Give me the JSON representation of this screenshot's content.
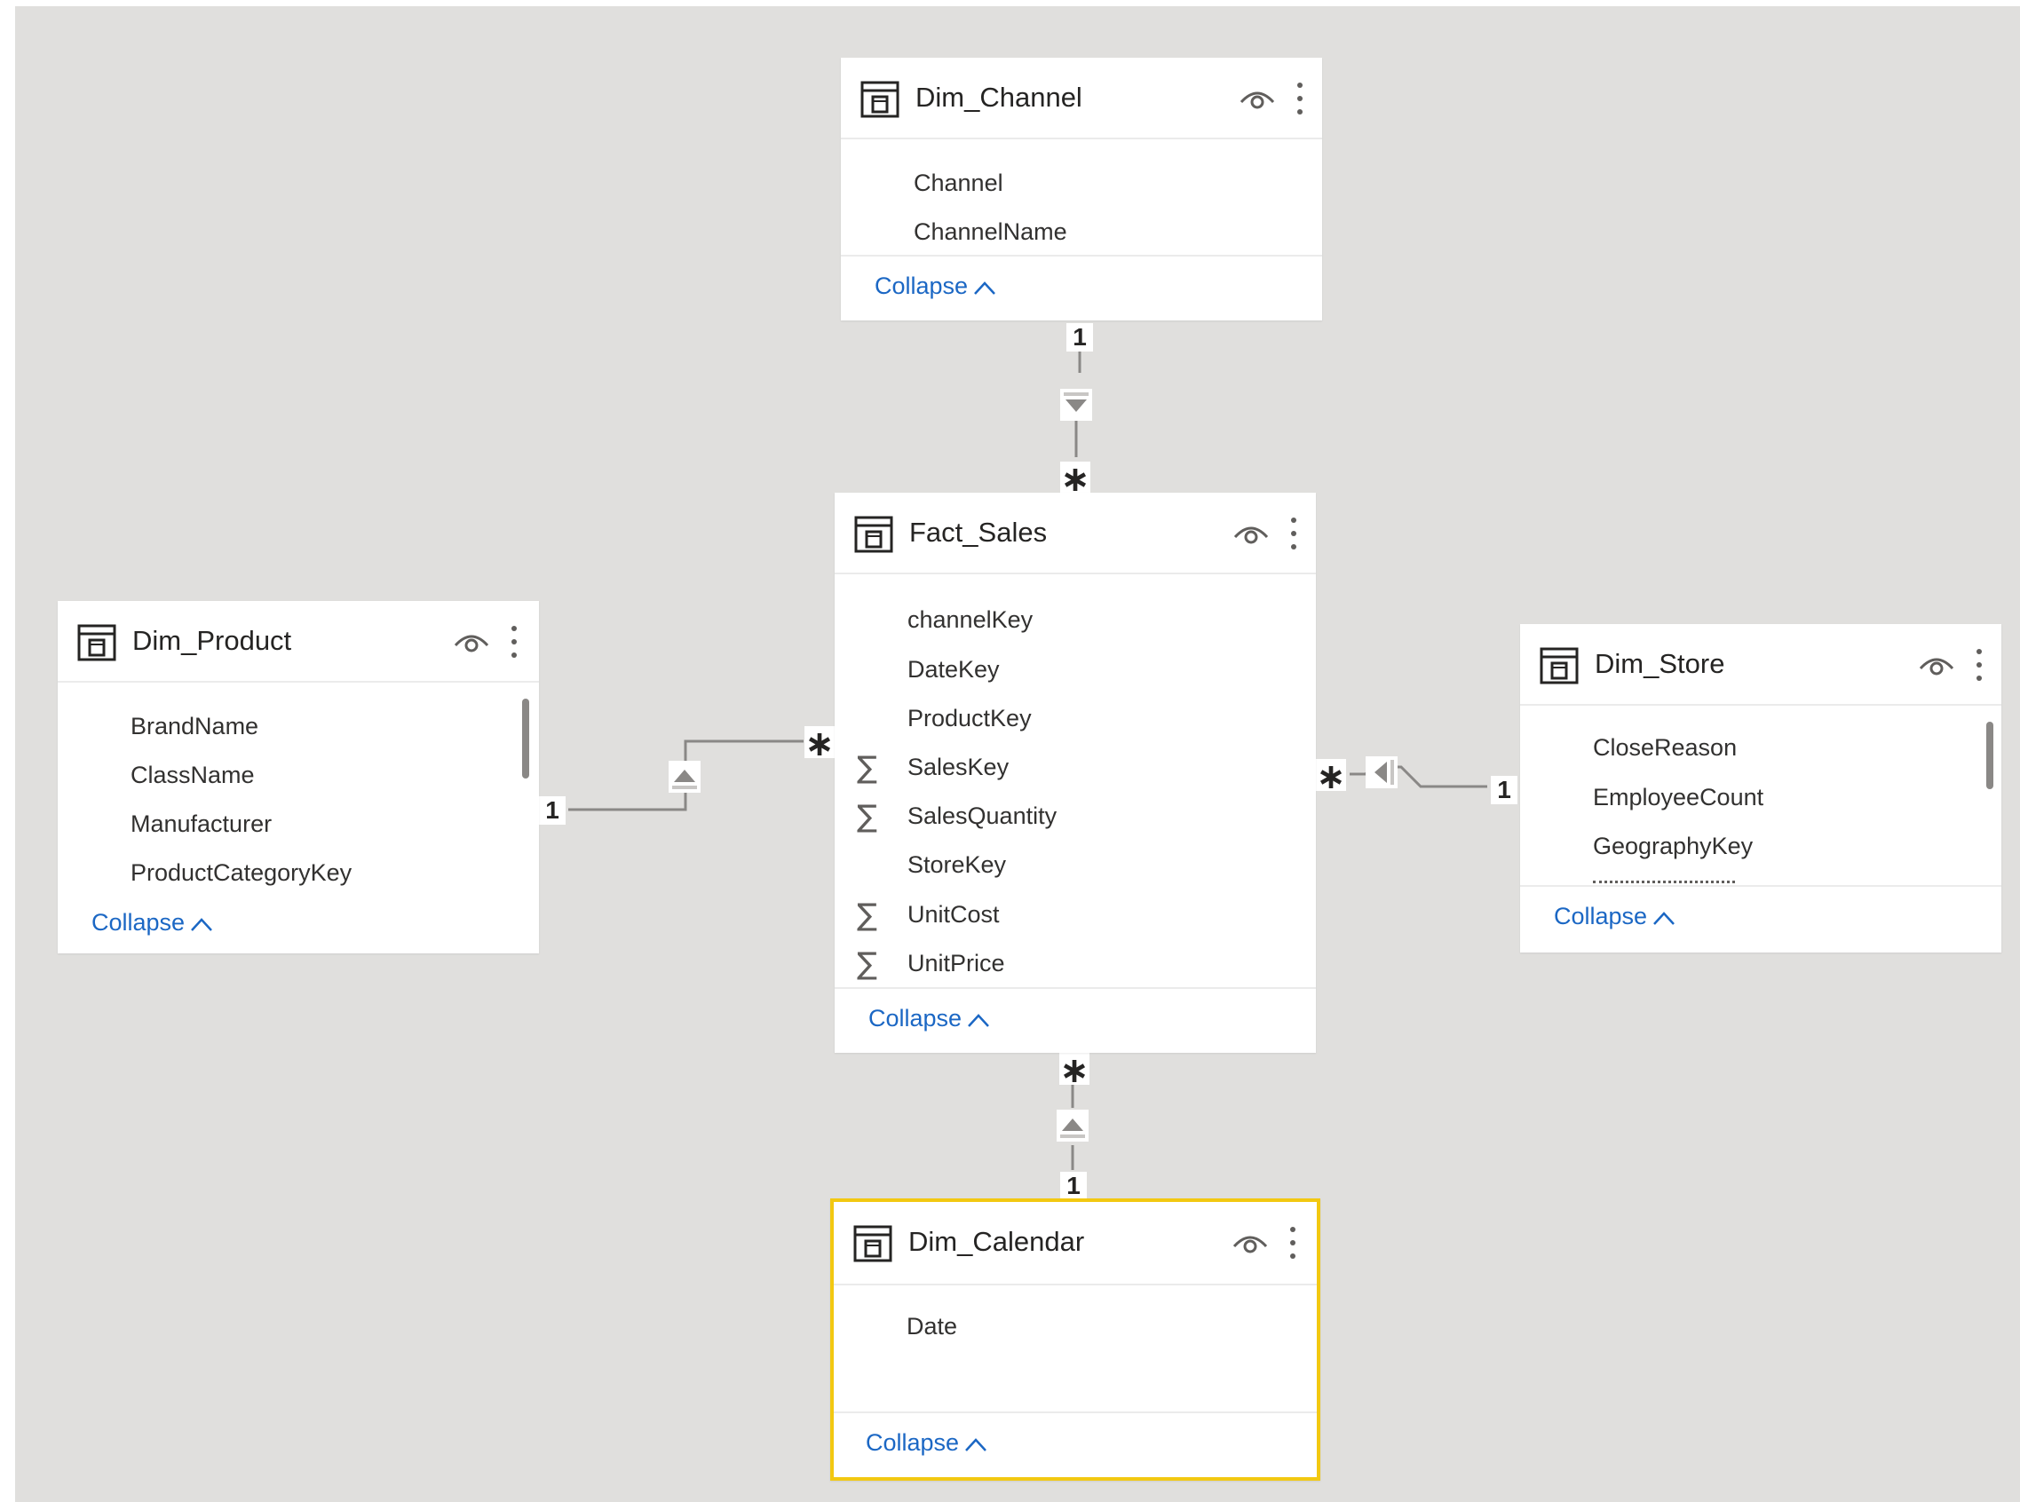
{
  "tables": {
    "dim_channel": {
      "title": "Dim_Channel",
      "fields": [
        "Channel",
        "ChannelName"
      ],
      "collapse_label": "Collapse"
    },
    "fact_sales": {
      "title": "Fact_Sales",
      "fields": [
        {
          "name": "channelKey",
          "aggregate": false
        },
        {
          "name": "DateKey",
          "aggregate": false
        },
        {
          "name": "ProductKey",
          "aggregate": false
        },
        {
          "name": "SalesKey",
          "aggregate": true
        },
        {
          "name": "SalesQuantity",
          "aggregate": true
        },
        {
          "name": "StoreKey",
          "aggregate": false
        },
        {
          "name": "UnitCost",
          "aggregate": true
        },
        {
          "name": "UnitPrice",
          "aggregate": true
        }
      ],
      "collapse_label": "Collapse"
    },
    "dim_product": {
      "title": "Dim_Product",
      "fields": [
        "BrandName",
        "ClassName",
        "Manufacturer",
        "ProductCategoryKey"
      ],
      "collapse_label": "Collapse"
    },
    "dim_store": {
      "title": "Dim_Store",
      "fields": [
        "CloseReason",
        "EmployeeCount",
        "GeographyKey"
      ],
      "collapse_label": "Collapse"
    },
    "dim_calendar": {
      "title": "Dim_Calendar",
      "fields": [
        "Date"
      ],
      "collapse_label": "Collapse",
      "selected": true
    }
  },
  "icons": {
    "sigma": "∑",
    "eye": "eye-icon",
    "more": "more-vertical-icon",
    "table": "table-icon"
  },
  "relationships": {
    "channel_sales": {
      "one": "1",
      "many": "∗"
    },
    "product_sales": {
      "one": "1",
      "many": "∗"
    },
    "store_sales": {
      "one": "1",
      "many": "∗"
    },
    "calendar_sales": {
      "one": "1",
      "many": "∗"
    }
  },
  "colors": {
    "canvas": "#e0dfdd",
    "link": "#1b67c4",
    "selected_border": "#f2c811",
    "connector": "#8a8886"
  }
}
